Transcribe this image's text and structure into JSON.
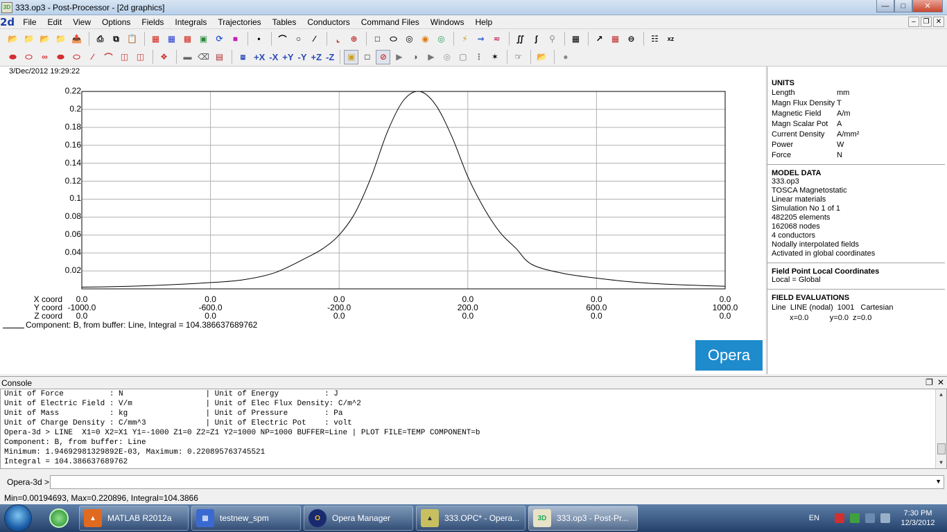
{
  "window": {
    "title": "333.op3 - Post-Processor - [2d graphics]"
  },
  "menu": {
    "mdi_label": "2d",
    "items": [
      "File",
      "Edit",
      "View",
      "Options",
      "Fields",
      "Integrals",
      "Trajectories",
      "Tables",
      "Conductors",
      "Command Files",
      "Windows",
      "Help"
    ]
  },
  "toolbar2": {
    "axis_labels": [
      "+X",
      "-X",
      "+Y",
      "-Y",
      "+Z",
      "-Z"
    ]
  },
  "graph": {
    "timestamp": "3/Dec/2012 19:29:22",
    "coord_labels": [
      "X coord",
      "Y coord",
      "Z coord"
    ],
    "x_positions": [
      {
        "x": "0.0",
        "y": "-1000.0",
        "z": "0.0"
      },
      {
        "x": "0.0",
        "y": "-600.0",
        "z": "0.0"
      },
      {
        "x": "0.0",
        "y": "-200.0",
        "z": "0.0"
      },
      {
        "x": "0.0",
        "y": "200.0",
        "z": "0.0"
      },
      {
        "x": "0.0",
        "y": "600.0",
        "z": "0.0"
      },
      {
        "x": "0.0",
        "y": "1000.0",
        "z": "0.0"
      }
    ],
    "component_label": "Component: B, from buffer: Line, Integral = 104.386637689762",
    "logo": "Opera"
  },
  "chart_data": {
    "type": "line",
    "title": "",
    "xlabel": "Y coord",
    "ylabel": "",
    "xlim": [
      -1000,
      1000
    ],
    "ylim": [
      0,
      0.22
    ],
    "yticks": [
      "0.22",
      "0.2",
      "0.18",
      "0.16",
      "0.14",
      "0.12",
      "0.1",
      "0.08",
      "0.06",
      "0.04",
      "0.02"
    ],
    "grid": true,
    "series": [
      {
        "name": "",
        "x": [
          -1000,
          -900,
          -800,
          -700,
          -600,
          -500,
          -400,
          -300,
          -250,
          -200,
          -150,
          -100,
          -50,
          0,
          50,
          100,
          150,
          200,
          250,
          300,
          350,
          400,
          500,
          600,
          700,
          800,
          900,
          1000
        ],
        "values": [
          0.0019,
          0.0025,
          0.0035,
          0.005,
          0.007,
          0.01,
          0.018,
          0.035,
          0.045,
          0.06,
          0.085,
          0.125,
          0.175,
          0.21,
          0.22,
          0.205,
          0.17,
          0.125,
          0.09,
          0.063,
          0.045,
          0.027,
          0.017,
          0.012,
          0.008,
          0.0055,
          0.004,
          0.0029
        ]
      }
    ]
  },
  "units": {
    "heading": "UNITS",
    "rows": [
      {
        "k": "Length",
        "v": "mm"
      },
      {
        "k": "Magn Flux Density",
        "v": "T"
      },
      {
        "k": "Magnetic Field",
        "v": "A/m"
      },
      {
        "k": "Magn Scalar Pot",
        "v": "A"
      },
      {
        "k": "Current Density",
        "v": "A/mm²"
      },
      {
        "k": "Power",
        "v": "W"
      },
      {
        "k": "Force",
        "v": "N"
      }
    ]
  },
  "model": {
    "heading": "MODEL DATA",
    "lines": [
      "333.op3",
      "TOSCA Magnetostatic",
      "Linear materials",
      "Simulation No 1 of 1",
      "482205 elements",
      "162068 nodes",
      "4 conductors",
      "Nodally interpolated fields",
      "Activated in global coordinates"
    ]
  },
  "fieldpoint": {
    "heading": "Field Point Local Coordinates",
    "value": "Local = Global"
  },
  "evaluations": {
    "heading": "FIELD EVALUATIONS",
    "line1": "Line  LINE (nodal)  1001   Cartesian",
    "line2": "x=0.0          y=0.0  z=0.0"
  },
  "console": {
    "title": "Console",
    "lines": [
      "Unit of Force          : N                  | Unit of Energy          : J",
      "Unit of Electric Field : V/m                | Unit of Elec Flux Density: C/m^2",
      "Unit of Mass           : kg                 | Unit of Pressure        : Pa",
      "Unit of Charge Density : C/mm^3             | Unit of Electric Pot    : volt",
      "Opera-3d > LINE  X1=0 X2=X1 Y1=-1000 Z1=0 Z2=Z1 Y2=1000 NP=1000 BUFFER=Line | PLOT FILE=TEMP COMPONENT=b",
      "Component: B, from buffer: Line",
      "Minimum: 1.94692981329892E-03, Maximum: 0.220895763745521",
      "Integral = 104.386637689762"
    ]
  },
  "command": {
    "prompt": "Opera-3d >",
    "value": ""
  },
  "status": {
    "text": "Min=0.00194693, Max=0.220896, Integral=104.3866"
  },
  "taskbar": {
    "apps": [
      {
        "label": "MATLAB  R2012a",
        "icon": "matlab-icon"
      },
      {
        "label": "testnew_spm",
        "icon": "simulink-icon"
      },
      {
        "label": "Opera Manager",
        "icon": "opera-manager-icon"
      },
      {
        "label": "333.OPC* - Opera...",
        "icon": "opera-modeller-icon"
      },
      {
        "label": "333.op3 - Post-Pr...",
        "icon": "post-processor-icon"
      }
    ],
    "lang": "EN",
    "time": "7:30 PM",
    "date": "12/3/2012"
  }
}
